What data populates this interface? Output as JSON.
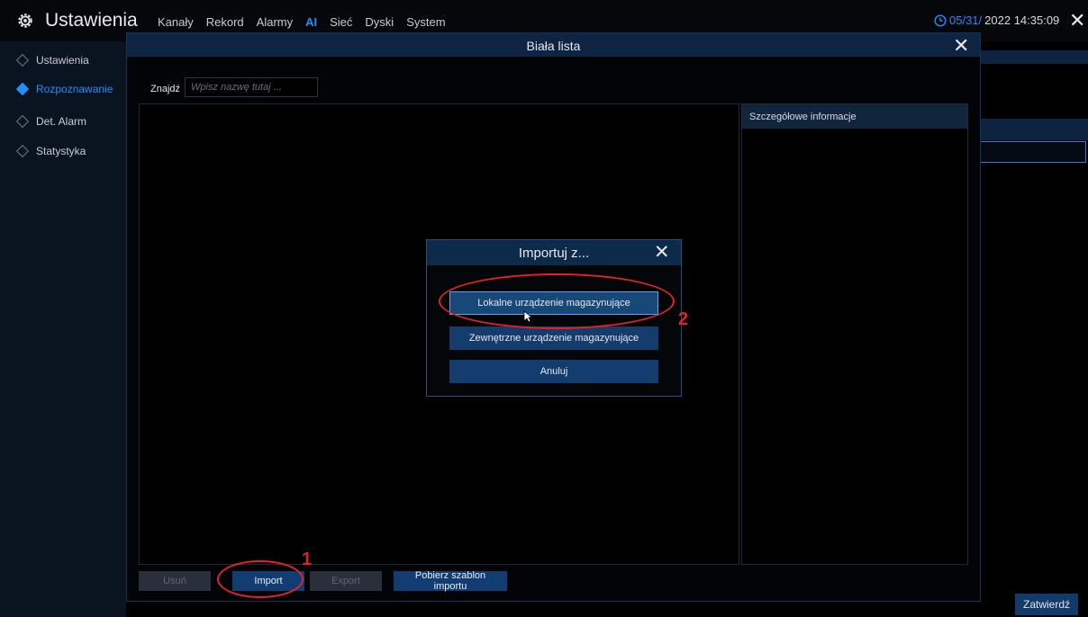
{
  "topbar": {
    "title": "Ustawienia",
    "nav": [
      "Kanały",
      "Rekord",
      "Alarmy",
      "AI",
      "Sieć",
      "Dyski",
      "System"
    ],
    "nav_active_index": 3,
    "datetime_part1": "05/31/",
    "datetime_part2": "2022 14:35:09"
  },
  "sidebar": {
    "items": [
      {
        "label": "Ustawienia"
      },
      {
        "label": "Rozpoznawanie"
      },
      {
        "label": "Det. Alarm"
      },
      {
        "label": "Statystyka"
      }
    ],
    "active_index": 1
  },
  "background": {
    "confirm_label": "Zatwierdź"
  },
  "dialog": {
    "title": "Biała lista",
    "find_label": "Znajdź",
    "find_placeholder": "Wpisz nazwę tutaj ...",
    "detail_title": "Szczegółowe informacje",
    "buttons": {
      "delete": "Usuń",
      "import": "Import",
      "export": "Export",
      "template": "Pobierz szablon importu"
    }
  },
  "import_dialog": {
    "title": "Importuj z...",
    "options": [
      {
        "label": "Lokalne urządzenie magazynujące"
      },
      {
        "label": "Zewnętrzne urządzenie magazynujące"
      },
      {
        "label": "Anuluj"
      }
    ]
  },
  "annotations": {
    "step1": "1",
    "step2": "2",
    "color": "#e0232a"
  },
  "colors": {
    "accent": "#1e90ff",
    "header": "#0d2542",
    "button": "#123d72"
  }
}
